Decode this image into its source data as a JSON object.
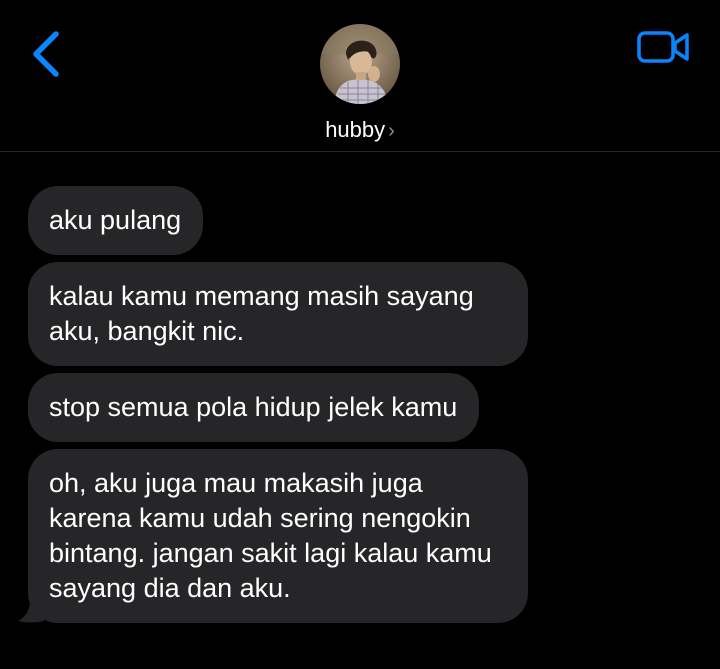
{
  "header": {
    "contact_name": "hubby",
    "chevron": "›",
    "back_icon": "chevron-left-icon",
    "video_icon": "video-camera-icon",
    "accent_color": "#0a84ff"
  },
  "messages": [
    {
      "text": "aku pulang"
    },
    {
      "text": "kalau kamu memang masih sayang aku, bangkit nic."
    },
    {
      "text": "stop semua pola hidup jelek kamu"
    },
    {
      "text": "oh, aku juga mau makasih juga karena kamu udah sering nengokin bintang. jangan sakit lagi kalau kamu sayang dia dan aku."
    }
  ],
  "colors": {
    "background": "#000000",
    "bubble_incoming": "#262628",
    "text": "#ffffff",
    "secondary": "#8e8e93"
  }
}
